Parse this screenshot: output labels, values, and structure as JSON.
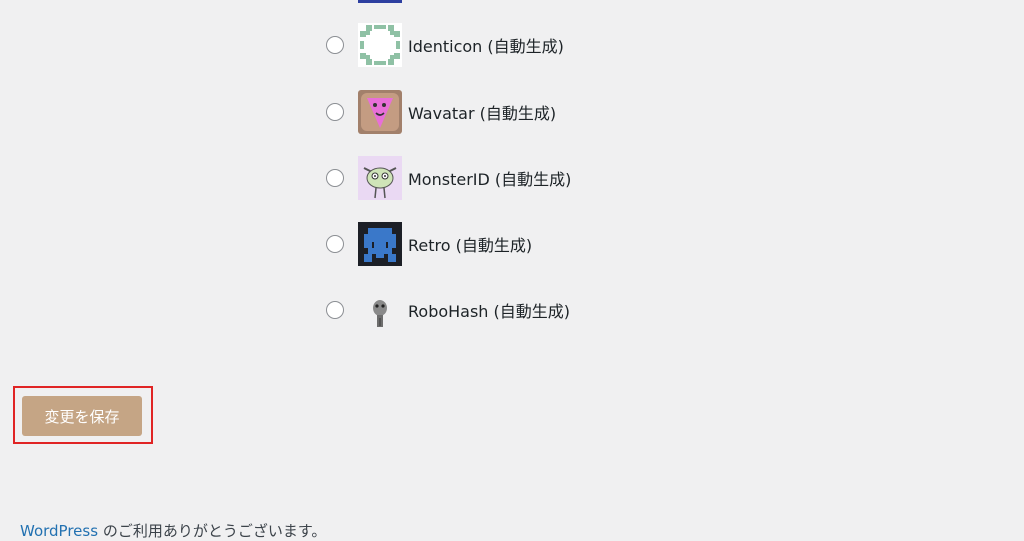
{
  "avatar_options": [
    {
      "label": "Identicon (自動生成)",
      "icon": "identicon-avatar",
      "checked": false
    },
    {
      "label": "Wavatar (自動生成)",
      "icon": "wavatar-avatar",
      "checked": false
    },
    {
      "label": "MonsterID (自動生成)",
      "icon": "monsterid-avatar",
      "checked": false
    },
    {
      "label": "Retro (自動生成)",
      "icon": "retro-avatar",
      "checked": false
    },
    {
      "label": "RoboHash (自動生成)",
      "icon": "robohash-avatar",
      "checked": false
    }
  ],
  "save_button": {
    "label": "変更を保存"
  },
  "footer": {
    "link_text": "WordPress",
    "text": " のご利用ありがとうございます。"
  },
  "colors": {
    "save_button": "#c5a585",
    "highlight": "#e02424",
    "link": "#2271b1"
  }
}
